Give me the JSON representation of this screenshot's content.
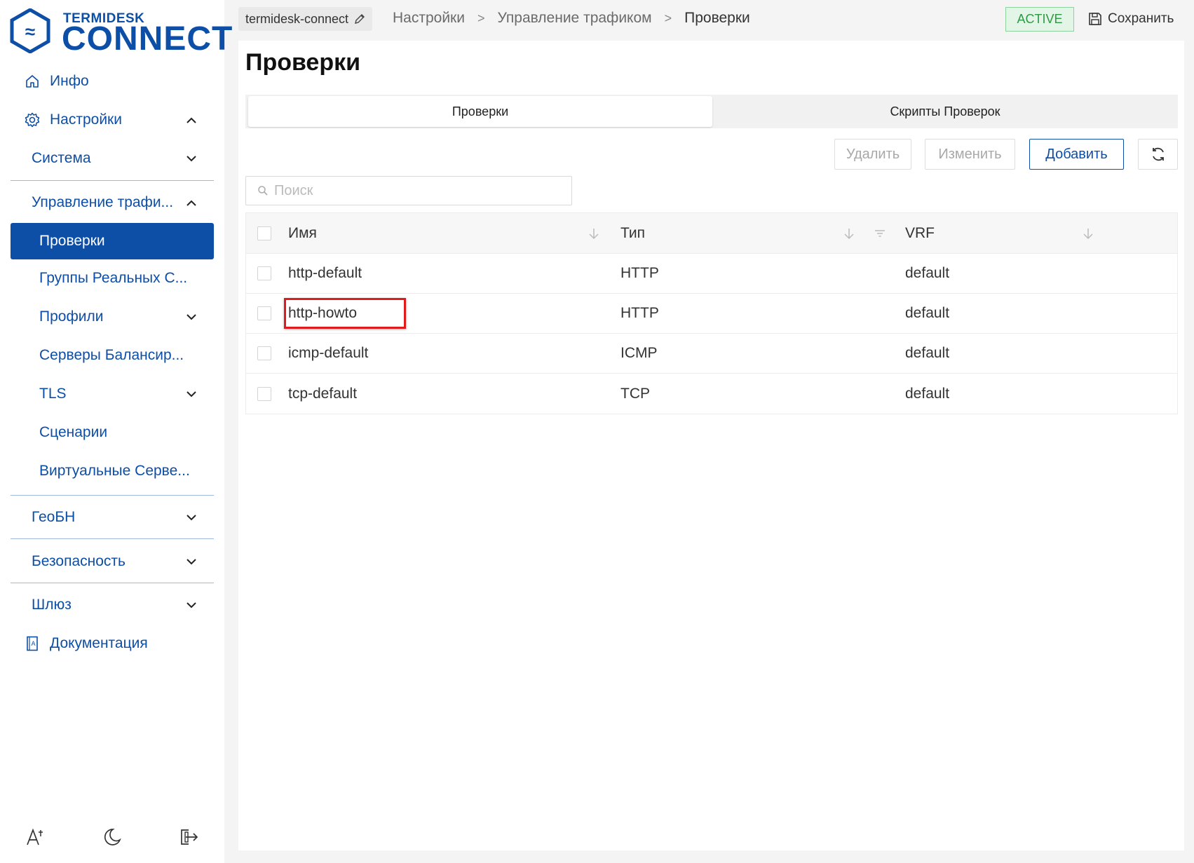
{
  "logo": {
    "top": "TERMIDESK",
    "main": "CONNECT"
  },
  "sidebar": {
    "items": [
      {
        "label": "Инфо"
      },
      {
        "label": "Настройки"
      },
      {
        "label": "Система"
      },
      {
        "label": "Управление трафи..."
      },
      {
        "label": "Проверки"
      },
      {
        "label": "Группы Реальных С..."
      },
      {
        "label": "Профили"
      },
      {
        "label": "Серверы Балансир..."
      },
      {
        "label": "TLS"
      },
      {
        "label": "Сценарии"
      },
      {
        "label": "Виртуальные Серве..."
      },
      {
        "label": "ГеоБН"
      },
      {
        "label": "Безопасность"
      },
      {
        "label": "Шлюз"
      },
      {
        "label": "Документация"
      }
    ]
  },
  "header": {
    "connection": "termidesk-connect",
    "breadcrumbs": [
      "Настройки",
      "Управление трафиком",
      "Проверки"
    ],
    "separator": ">",
    "status": "ACTIVE",
    "save_label": "Сохранить"
  },
  "main": {
    "title": "Проверки",
    "tabs": [
      {
        "label": "Проверки"
      },
      {
        "label": "Скрипты Проверок"
      }
    ],
    "toolbar": {
      "delete_label": "Удалить",
      "edit_label": "Изменить",
      "add_label": "Добавить"
    },
    "search": {
      "placeholder": "Поиск",
      "value": ""
    },
    "table": {
      "columns": [
        "Имя",
        "Тип",
        "VRF"
      ],
      "rows": [
        {
          "name": "http-default",
          "type": "HTTP",
          "vrf": "default"
        },
        {
          "name": "http-howto",
          "type": "HTTP",
          "vrf": "default"
        },
        {
          "name": "icmp-default",
          "type": "ICMP",
          "vrf": "default"
        },
        {
          "name": "tcp-default",
          "type": "TCP",
          "vrf": "default"
        }
      ],
      "highlighted_row": 1
    }
  },
  "colors": {
    "brand": "#0d4ea6",
    "status_bg": "#e3f5e7",
    "status_text": "#2d9a45",
    "highlight": "#e01b1b"
  },
  "icons": [
    "home-icon",
    "gear-icon",
    "chevron-up-icon",
    "chevron-down-icon",
    "book-icon",
    "text-size-icon",
    "moon-icon",
    "logout-icon",
    "pencil-icon",
    "save-icon",
    "refresh-icon",
    "search-icon",
    "sort-down-icon",
    "filter-icon"
  ]
}
